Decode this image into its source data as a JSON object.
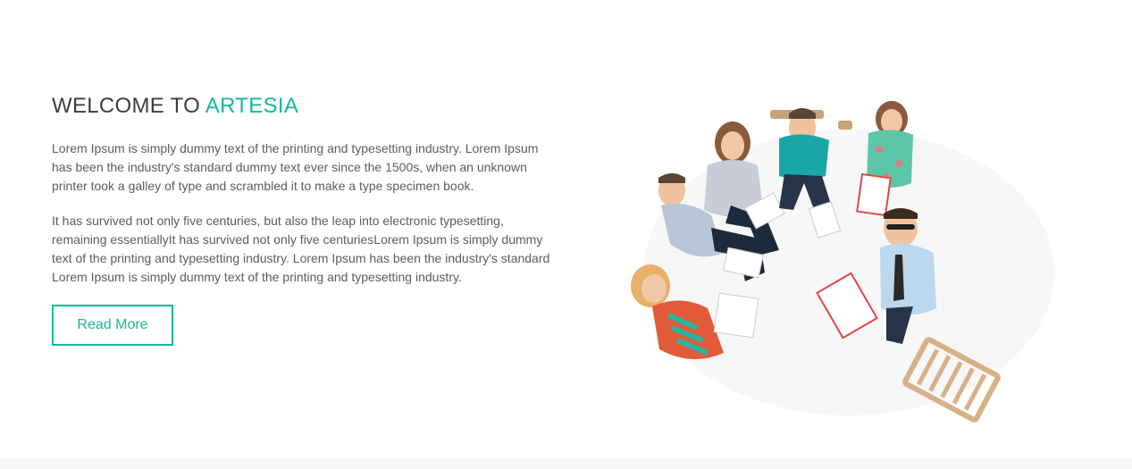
{
  "welcome": {
    "heading_prefix": "WELCOME TO ",
    "heading_accent": "ARTESIA",
    "paragraph1": "Lorem Ipsum is simply dummy text of the printing and typesetting industry. Lorem Ipsum has been the industry's standard dummy text ever since the 1500s, when an unknown printer took a galley of type and scrambled it to make a type specimen book.",
    "paragraph2": "It has survived not only five centuries, but also the leap into electronic typesetting, remaining essentiallyIt has survived not only five centuriesLorem Ipsum is simply dummy text of the printing and typesetting industry. Lorem Ipsum has been the industry's standard Lorem Ipsum is simply dummy text of the printing and typesetting industry.",
    "button_label": "Read More"
  },
  "colors": {
    "accent": "#15b99a",
    "heading": "#3d3d3d",
    "body_text": "#5c5c5c"
  },
  "image": {
    "subject": "team-photo-overhead"
  }
}
